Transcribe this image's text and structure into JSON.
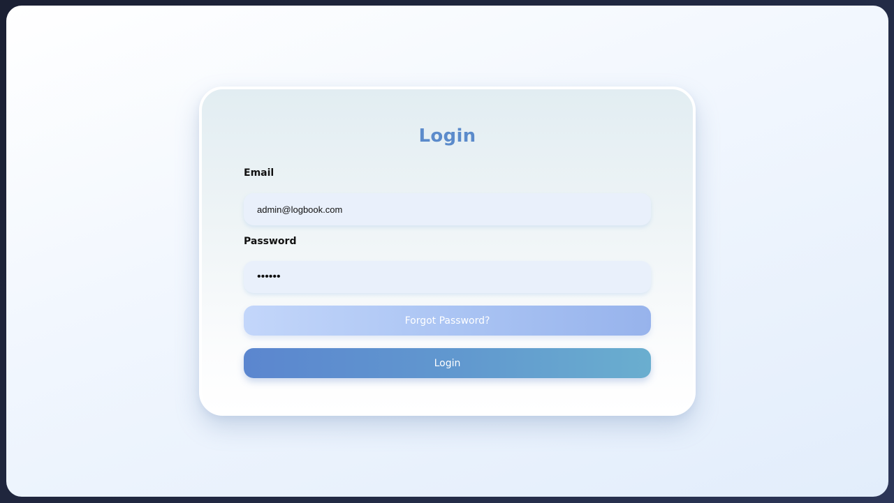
{
  "login_form": {
    "title": "Login",
    "email": {
      "label": "Email",
      "value": "admin@logbook.com"
    },
    "password": {
      "label": "Password",
      "value": "••••••"
    },
    "forgot_password_label": "Forgot Password?",
    "login_button_label": "Login"
  },
  "colors": {
    "title": "#5b8bcb",
    "input_background": "#e9f0fb",
    "forgot_button_start": "#c3d6fa",
    "forgot_button_end": "#97b3ec",
    "login_button_start": "#5b86cf",
    "login_button_end": "#6aaecf"
  }
}
